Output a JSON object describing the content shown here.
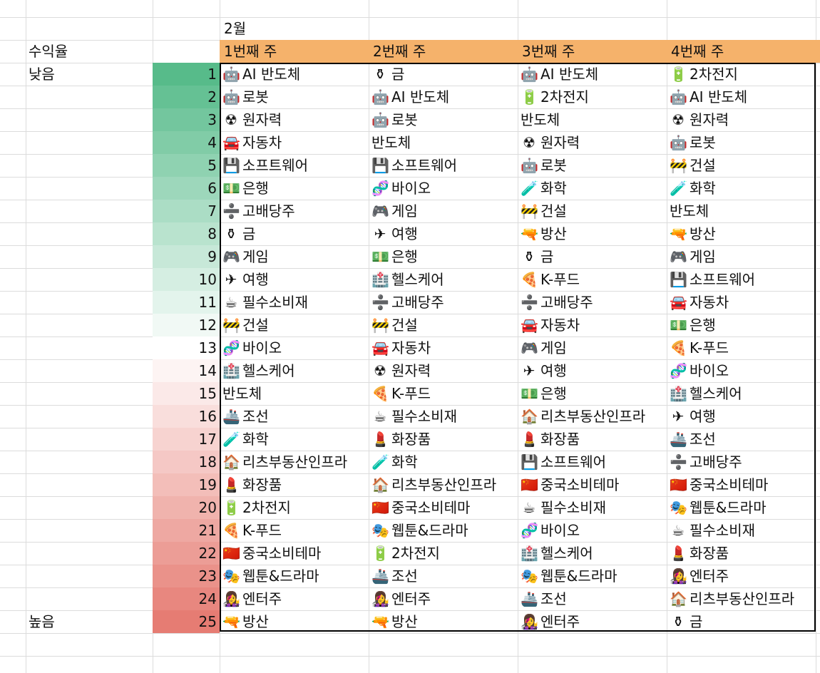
{
  "month": "2월",
  "label_yield": "수익율",
  "label_low": "낮음",
  "label_high": "높음",
  "weeks": [
    "1번째 주",
    "2번째 주",
    "3번째 주",
    "4번째 주"
  ],
  "ranks": [
    "1",
    "2",
    "3",
    "4",
    "5",
    "6",
    "7",
    "8",
    "9",
    "10",
    "11",
    "12",
    "13",
    "14",
    "15",
    "16",
    "17",
    "18",
    "19",
    "20",
    "21",
    "22",
    "23",
    "24",
    "25"
  ],
  "colors": {
    "header": "#f5b26b",
    "green": "#57bb8a",
    "red": "#e67c73"
  },
  "icons": {
    "AI 반도체": "🤖",
    "로봇": "🤖",
    "원자력": "☢",
    "자동차": "🚘",
    "소프트웨어": "💾",
    "은행": "💵",
    "고배당주": "➗",
    "금": "⚱",
    "게임": "🎮",
    "여행": "✈",
    "필수소비재": "☕",
    "건설": "🚧",
    "바이오": "🧬",
    "헬스케어": "🏥",
    "반도체": "",
    "조선": "🚢",
    "화학": "🧪",
    "리츠부동산인프라": "🏠",
    "화장품": "💄",
    "2차전지": "🔋",
    "K-푸드": "🍕",
    "중국소비테마": "🇨🇳",
    "웹툰&드라마": "🎭",
    "엔터주": "👩‍🎤",
    "방산": "🔫"
  },
  "columns": [
    [
      "AI 반도체",
      "로봇",
      "원자력",
      "자동차",
      "소프트웨어",
      "은행",
      "고배당주",
      "금",
      "게임",
      "여행",
      "필수소비재",
      "건설",
      "바이오",
      "헬스케어",
      "반도체",
      "조선",
      "화학",
      "리츠부동산인프라",
      "화장품",
      "2차전지",
      "K-푸드",
      "중국소비테마",
      "웹툰&드라마",
      "엔터주",
      "방산"
    ],
    [
      "금",
      "AI 반도체",
      "로봇",
      "반도체",
      "소프트웨어",
      "바이오",
      "게임",
      "여행",
      "은행",
      "헬스케어",
      "고배당주",
      "건설",
      "자동차",
      "원자력",
      "K-푸드",
      "필수소비재",
      "화장품",
      "화학",
      "리츠부동산인프라",
      "중국소비테마",
      "웹툰&드라마",
      "2차전지",
      "조선",
      "엔터주",
      "방산"
    ],
    [
      "AI 반도체",
      "2차전지",
      "반도체",
      "원자력",
      "로봇",
      "화학",
      "건설",
      "방산",
      "금",
      "K-푸드",
      "고배당주",
      "자동차",
      "게임",
      "여행",
      "은행",
      "리츠부동산인프라",
      "화장품",
      "소프트웨어",
      "중국소비테마",
      "필수소비재",
      "바이오",
      "헬스케어",
      "웹툰&드라마",
      "조선",
      "엔터주"
    ],
    [
      "2차전지",
      "AI 반도체",
      "원자력",
      "로봇",
      "건설",
      "화학",
      "반도체",
      "방산",
      "게임",
      "소프트웨어",
      "자동차",
      "은행",
      "K-푸드",
      "바이오",
      "헬스케어",
      "여행",
      "조선",
      "고배당주",
      "중국소비테마",
      "웹툰&드라마",
      "필수소비재",
      "화장품",
      "엔터주",
      "리츠부동산인프라",
      "금"
    ]
  ]
}
